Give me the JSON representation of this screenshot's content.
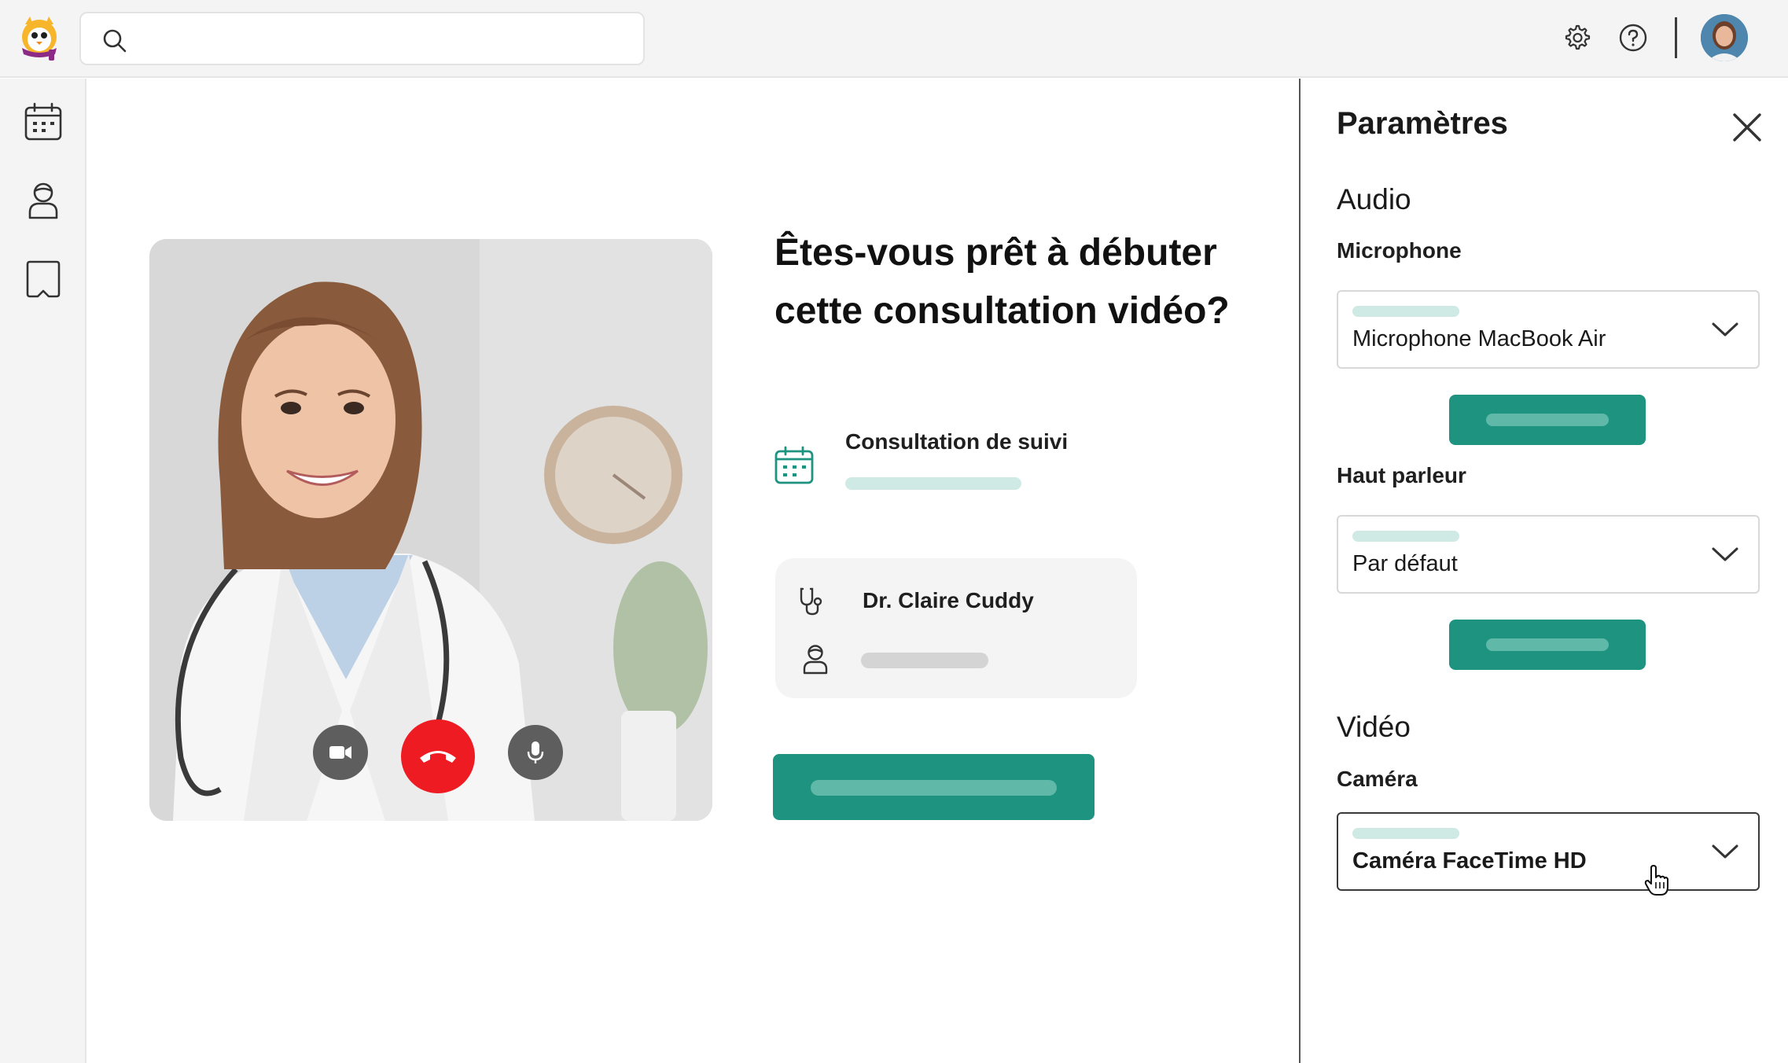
{
  "header": {
    "search_placeholder": "",
    "icons": [
      "search-icon",
      "gear-icon",
      "help-icon"
    ],
    "avatar": "user-avatar"
  },
  "sidenav": {
    "items": [
      "calendar-icon",
      "patient-icon",
      "book-icon"
    ]
  },
  "main": {
    "title": "Êtes-vous prêt à débuter cette consultation vidéo?",
    "appointment_type": "Consultation de suivi",
    "doctor_name": "Dr. Claire Cuddy",
    "video_controls": [
      "camera",
      "hang-up",
      "microphone"
    ]
  },
  "settings": {
    "title": "Paramètres",
    "audio_section": "Audio",
    "microphone_label": "Microphone",
    "microphone_value": "Microphone MacBook Air",
    "speaker_label": "Haut parleur",
    "speaker_value": "Par défaut",
    "video_section": "Vidéo",
    "camera_label": "Caméra",
    "camera_value": "Caméra FaceTime HD"
  },
  "colors": {
    "accent": "#1e9480",
    "accent_light": "#cfe9e4",
    "hangup": "#ee1b22",
    "surface": "#f4f4f4"
  }
}
